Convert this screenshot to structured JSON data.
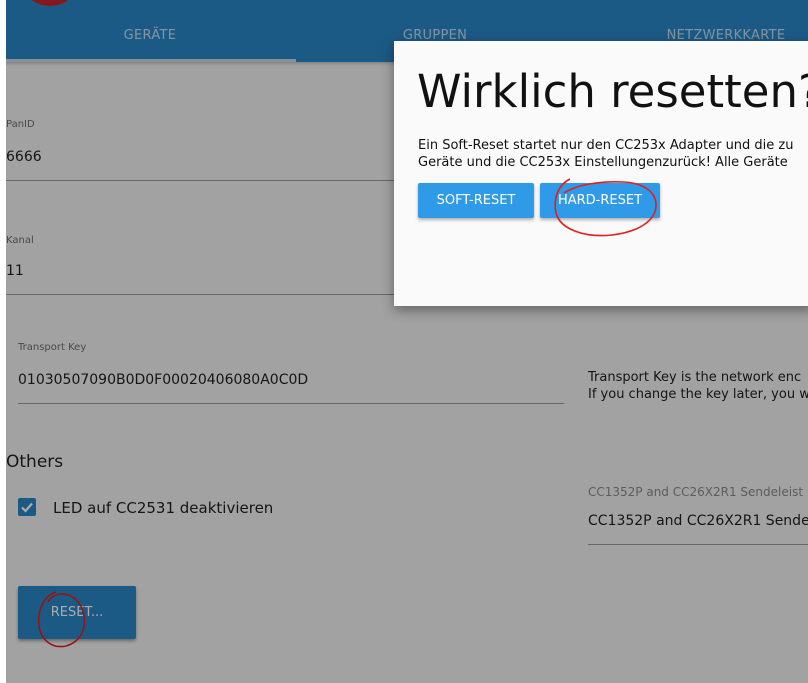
{
  "header": {
    "tabs": [
      {
        "label": "GERÄTE"
      },
      {
        "label": "GRUPPEN"
      },
      {
        "label": "NETZWERKKARTE"
      }
    ]
  },
  "form": {
    "panid": {
      "label": "PanID",
      "value": "6666"
    },
    "kanal": {
      "label": "Kanal",
      "value": "11"
    },
    "transport_key": {
      "label": "Transport Key",
      "value": "01030507090B0D0F00020406080A0C0D",
      "help_line1": "Transport Key is the network enc",
      "help_line2": "If you change the key later, you w"
    }
  },
  "others": {
    "title": "Others",
    "checkbox_label": "LED auf CC2531 deaktivieren",
    "checked": true,
    "power_label": "CC1352P and CC26X2R1 Sendeleist",
    "power_value": "CC1352P and CC26X2R1 Sende"
  },
  "reset_button": {
    "label": "RESET..."
  },
  "dialog": {
    "title": "Wirklich resetten?",
    "text_line1": "Ein Soft-Reset startet nur den CC253x Adapter und die zu",
    "text_line2": "Geräte und die CC253x Einstellungenzurück! Alle Geräte",
    "soft_reset_label": "SOFT-RESET",
    "hard_reset_label": "HARD-RESET"
  },
  "colors": {
    "header": "#2b87c8",
    "accent_button": "#2f9ae8",
    "annotation": "#e0201e"
  }
}
